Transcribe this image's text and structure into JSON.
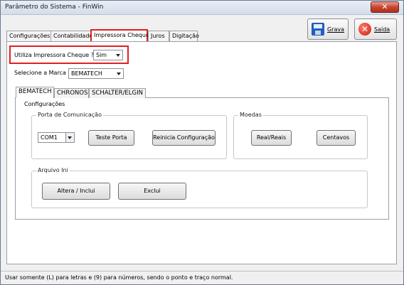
{
  "window": {
    "title": "Parâmetro do Sistema - FinWin",
    "close_glyph": "✕"
  },
  "toolbar": {
    "save_label": "Grava",
    "exit_label": "Saída",
    "exit_glyph": "✕"
  },
  "tabs": [
    {
      "label": "Configurações"
    },
    {
      "label": "Contabilidade"
    },
    {
      "label": "Impressora Cheque"
    },
    {
      "label": "Juros"
    },
    {
      "label": "Digitação"
    }
  ],
  "cheque": {
    "uses_printer_label": "Utiliza Impressora Cheque ?",
    "uses_printer_value": "Sim",
    "brand_label": "Selecione a Marca",
    "brand_value": "BEMATECH"
  },
  "subtabs": [
    {
      "label": "BEMATECH"
    },
    {
      "label": "CHRONOS"
    },
    {
      "label": "SCHALTER/ELGIN"
    }
  ],
  "config": {
    "title": "Configurações",
    "port_group": {
      "title": "Porta de Comunicação",
      "port_value": "COM1",
      "test_port_label": "Teste Porta",
      "reset_config_label": "Reinicia Configuração"
    },
    "currency_group": {
      "title": "Moedas",
      "real_label": "Real/Reais",
      "cents_label": "Centavos"
    },
    "ini_group": {
      "title": "Arquivo Ini",
      "edit_label": "Altera / Inclui",
      "delete_label": "Exclui"
    }
  },
  "status": {
    "text": "Usar somente (L) para letras e (9) para números, sendo o ponto e traço normal."
  }
}
